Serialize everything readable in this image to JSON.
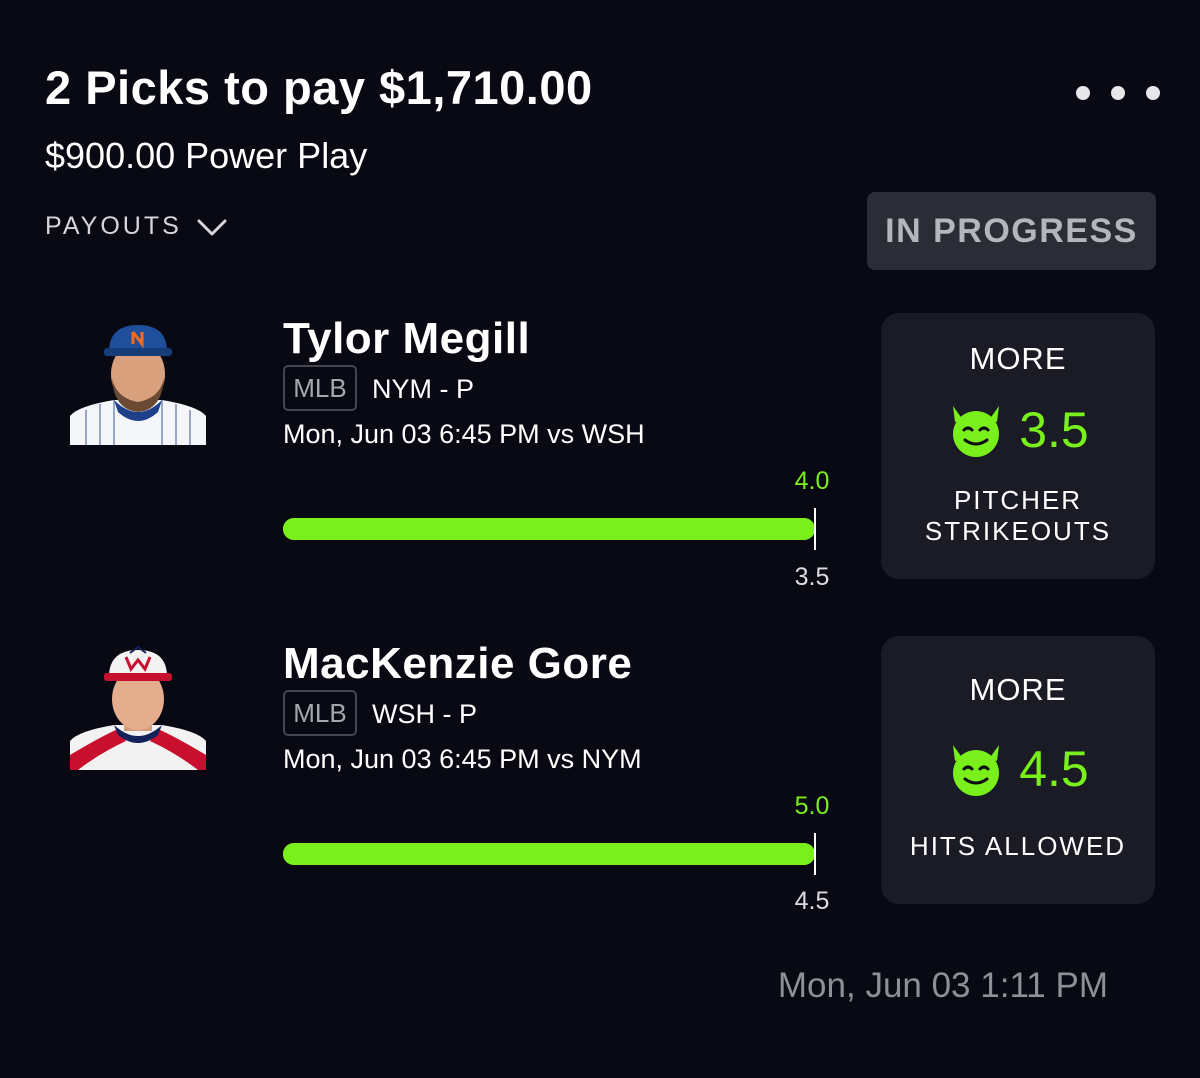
{
  "header": {
    "title": "2 Picks to pay $1,710.00",
    "subtitle": "$900.00 Power Play",
    "payouts_label": "PAYOUTS",
    "status": "IN PROGRESS"
  },
  "picks": [
    {
      "player": "Tylor Megill",
      "league": "MLB",
      "team_position": "NYM - P",
      "game_time": "Mon, Jun 03 6:45 PM  vs WSH",
      "current_value": "4.0",
      "line_value": "3.5",
      "progress": 1.0,
      "direction": "MORE",
      "line": "3.5",
      "stat_line1": "PITCHER",
      "stat_line2": "STRIKEOUTS",
      "cap_color": "#1f4f9a",
      "jersey_color": "#1e3f8a"
    },
    {
      "player": "MacKenzie Gore",
      "league": "MLB",
      "team_position": "WSH - P",
      "game_time": "Mon, Jun 03 6:45 PM  vs NYM",
      "current_value": "5.0",
      "line_value": "4.5",
      "progress": 1.0,
      "direction": "MORE",
      "line": "4.5",
      "stat_line1": "HITS ALLOWED",
      "stat_line2": "",
      "cap_color": "#f2f2f2",
      "jersey_color": "#c8102e"
    }
  ],
  "footer": {
    "timestamp": "Mon, Jun 03 1:11 PM"
  },
  "colors": {
    "background": "#080913",
    "accent_green": "#79f01c",
    "card": "#1a1b25",
    "badge": "#2b2c36"
  }
}
